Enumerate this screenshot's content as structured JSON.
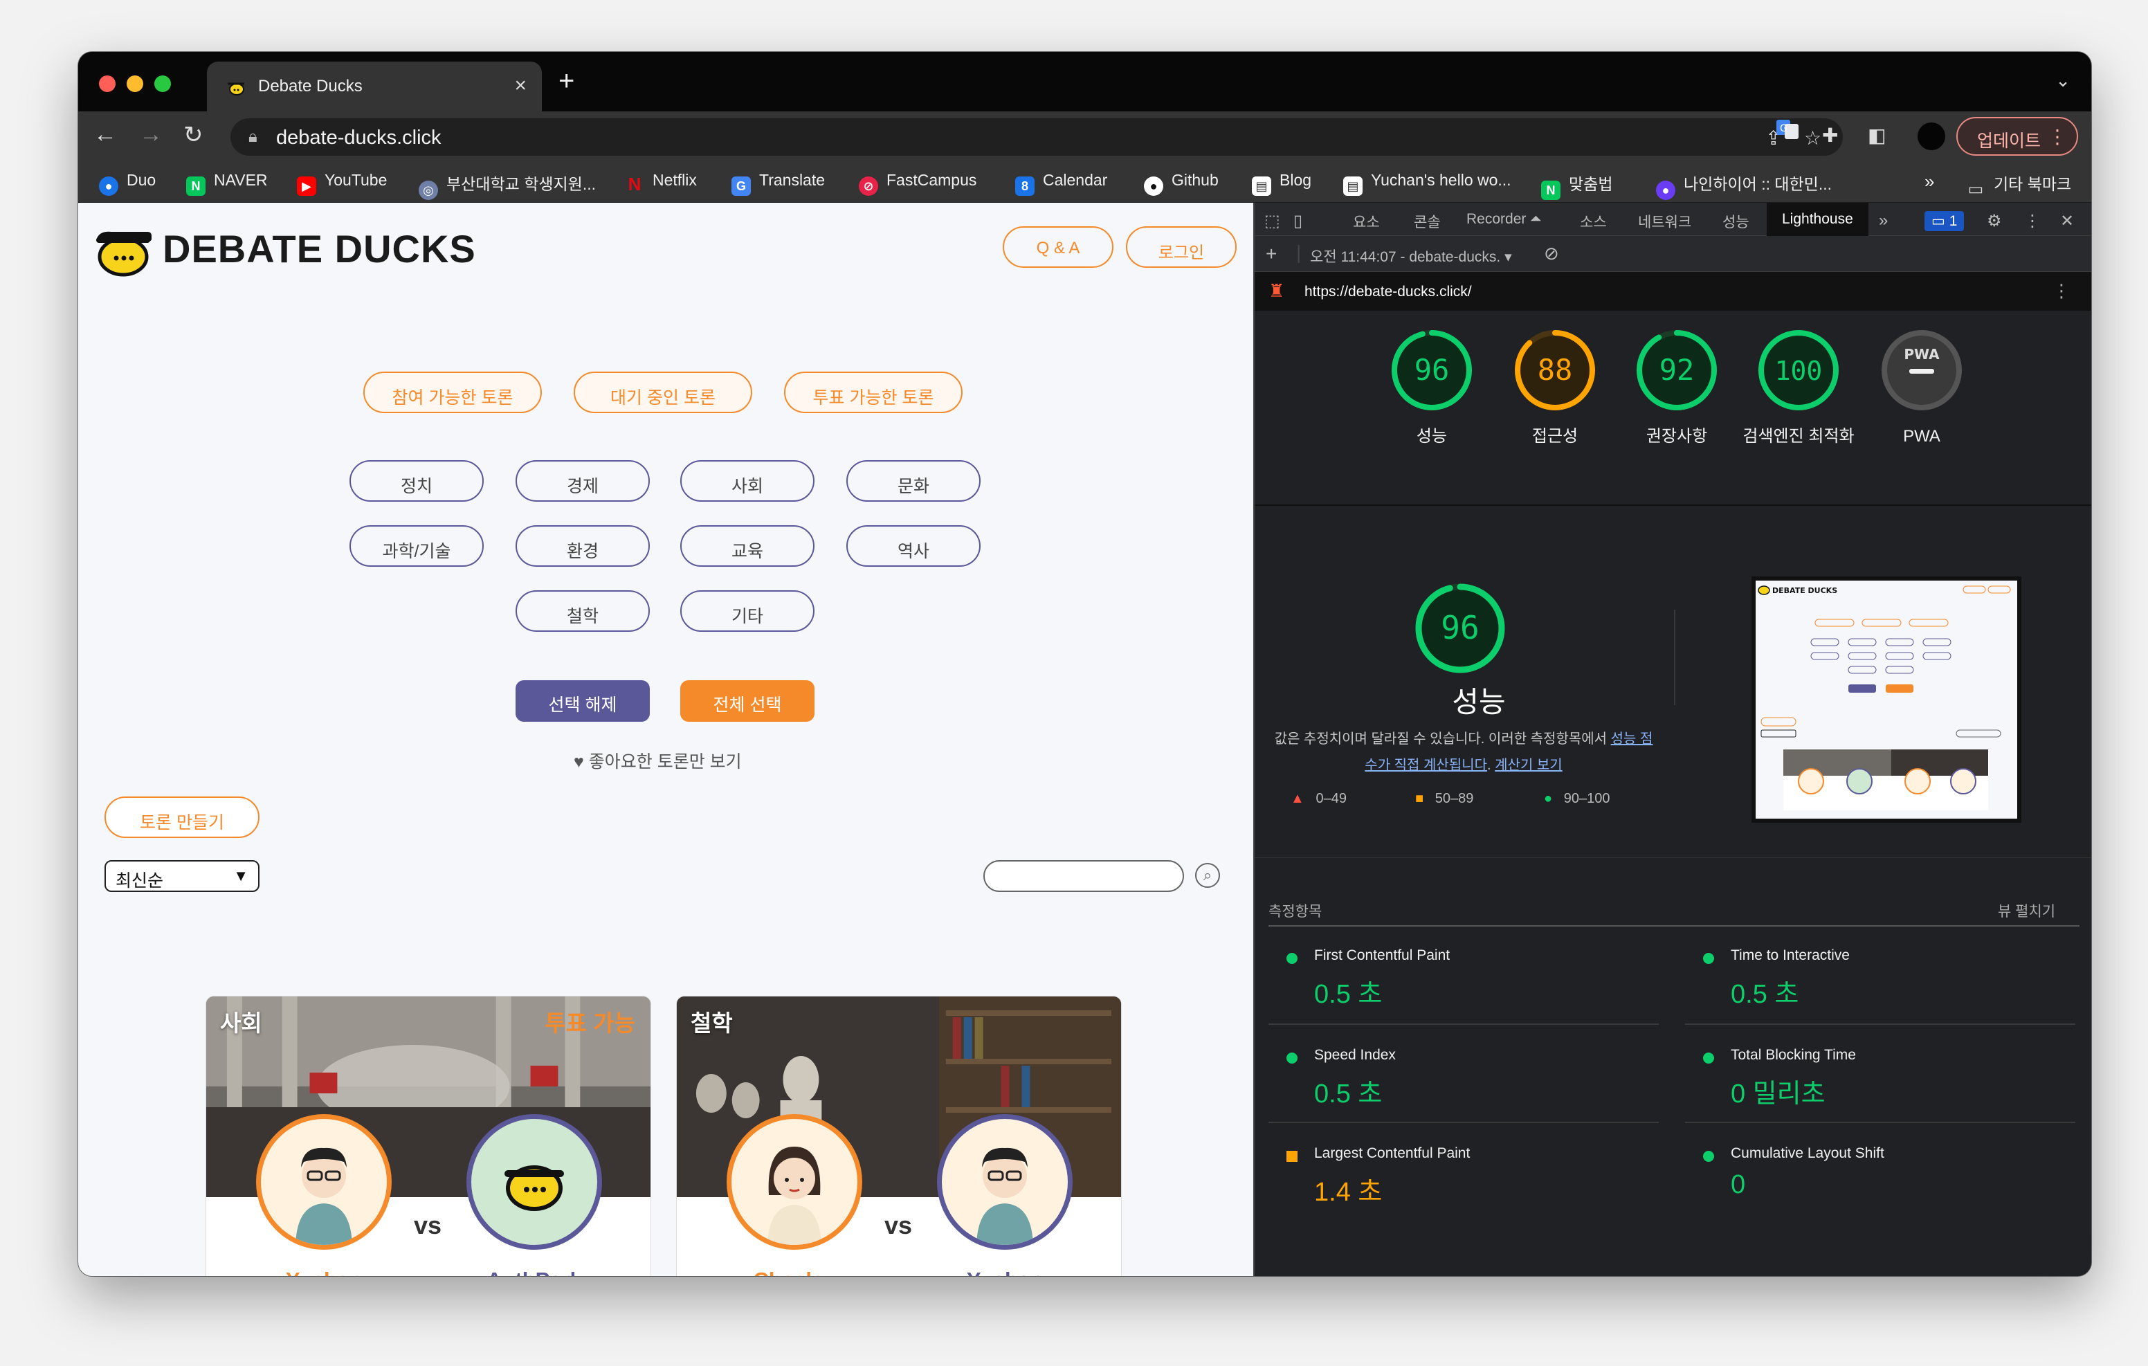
{
  "browser": {
    "tab_title": "Debate Ducks",
    "url": "debate-ducks.click",
    "update_label": "업데이트",
    "bookmarks": [
      {
        "label": "Duo",
        "icon": "duo-icon"
      },
      {
        "label": "NAVER",
        "icon": "naver-icon"
      },
      {
        "label": "YouTube",
        "icon": "youtube-icon"
      },
      {
        "label": "부산대학교 학생지원...",
        "icon": "pnu-icon"
      },
      {
        "label": "Netflix",
        "icon": "netflix-icon"
      },
      {
        "label": "Translate",
        "icon": "translate-icon"
      },
      {
        "label": "FastCampus",
        "icon": "fastcampus-icon"
      },
      {
        "label": "Calendar",
        "icon": "calendar-icon"
      },
      {
        "label": "Github",
        "icon": "github-icon"
      },
      {
        "label": "Blog",
        "icon": "blog-icon"
      },
      {
        "label": "Yuchan's hello wo...",
        "icon": "notion-icon"
      },
      {
        "label": "맞춤법",
        "icon": "naver-icon"
      },
      {
        "label": "나인하이어 :: 대한민...",
        "icon": "ninehire-icon"
      }
    ],
    "bookmarks_more": "»",
    "other_bookmarks": "기타 북마크"
  },
  "site": {
    "brand": "DEBATE DUCKS",
    "qa_label": "Q & A",
    "login_label": "로그인",
    "status_filters": [
      "참여 가능한 토론",
      "대기 중인 토론",
      "투표 가능한 토론"
    ],
    "categories": [
      "정치",
      "경제",
      "사회",
      "문화",
      "과학/기술",
      "환경",
      "교육",
      "역사",
      "철학",
      "기타"
    ],
    "deselect_label": "선택 해제",
    "select_all_label": "전체 선택",
    "liked_only_label": "♥ 좋아요한 토론만 보기",
    "create_label": "토론 만들기",
    "sort_value": "최신순",
    "cards": [
      {
        "category": "사회",
        "status": "투표 가능",
        "left_name": "Yuchan",
        "right_name": "AuthPark",
        "vs": "vs"
      },
      {
        "category": "철학",
        "status": "",
        "left_name": "Chesley",
        "right_name": "Yuchan",
        "vs": "vs"
      }
    ]
  },
  "devtools": {
    "tabs": [
      "요소",
      "콘솔",
      "Recorder ⏶",
      "소스",
      "네트워크",
      "성능",
      "Lighthouse"
    ],
    "active_tab": "Lighthouse",
    "issues_count": "1",
    "report_label": "오전 11:44:07 - debate-ducks.",
    "report_url": "https://debate-ducks.click/",
    "scores": [
      {
        "value": "96",
        "label": "성능",
        "color": "#0cce6b"
      },
      {
        "value": "88",
        "label": "접근성",
        "color": "#ffa400"
      },
      {
        "value": "92",
        "label": "권장사항",
        "color": "#0cce6b"
      },
      {
        "value": "100",
        "label": "검색엔진 최적화",
        "color": "#0cce6b"
      },
      {
        "value": "PWA",
        "label": "PWA",
        "color": "#777777"
      }
    ],
    "performance": {
      "score": "96",
      "label": "성능",
      "desc_1": "값은 추정치이며 달라질 수 있습니다. 이러한 측정항목에서",
      "desc_link_1": "성능 점수가 직접 계산됩니다",
      "desc_link_2": "계산기 보기",
      "legend": [
        "0–49",
        "50–89",
        "90–100"
      ]
    },
    "metrics_header": "측정항목",
    "expand_view": "뷰 펼치기",
    "metrics": [
      {
        "label": "First Contentful Paint",
        "value": "0.5 초",
        "status": "good"
      },
      {
        "label": "Time to Interactive",
        "value": "0.5 초",
        "status": "good"
      },
      {
        "label": "Speed Index",
        "value": "0.5 초",
        "status": "good"
      },
      {
        "label": "Total Blocking Time",
        "value": "0 밀리초",
        "status": "good"
      },
      {
        "label": "Largest Contentful Paint",
        "value": "1.4 초",
        "status": "average"
      },
      {
        "label": "Cumulative Layout Shift",
        "value": "0",
        "status": "good"
      }
    ],
    "colors": {
      "good": "#0cce6b",
      "average": "#ffa400",
      "poor": "#ff4e42"
    }
  }
}
